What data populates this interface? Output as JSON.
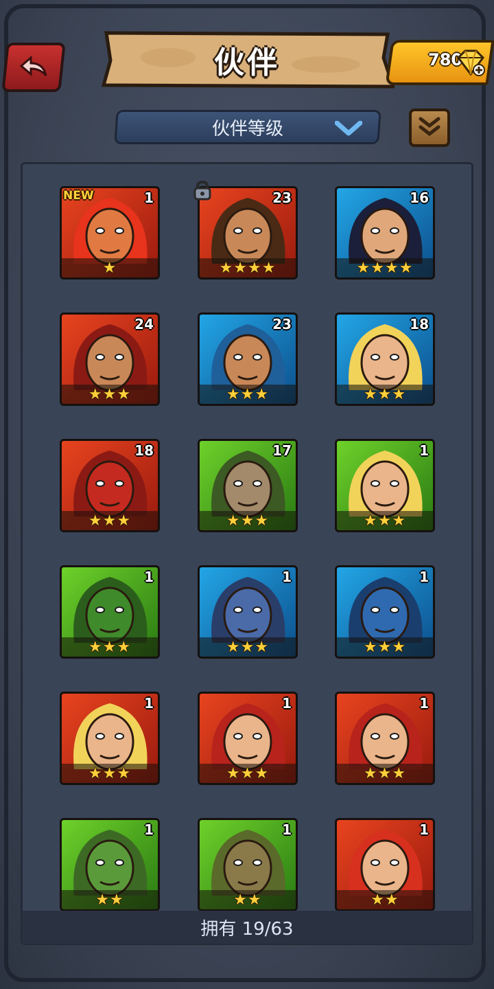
{
  "header": {
    "title": "伙伴",
    "currency_amount": "780"
  },
  "sort": {
    "label": "伙伴等级"
  },
  "companions": [
    {
      "level": "1",
      "stars": "★",
      "badge": "NEW",
      "color": "red",
      "locked": false,
      "face": "#e07a42",
      "hair": "#e8331d"
    },
    {
      "level": "23",
      "stars": "★★★★",
      "badge": "",
      "color": "red",
      "locked": true,
      "face": "#c98857",
      "hair": "#4a2a14"
    },
    {
      "level": "16",
      "stars": "★★★★",
      "badge": "",
      "color": "blue",
      "locked": false,
      "face": "#e0a87a",
      "hair": "#1b1f3a"
    },
    {
      "level": "24",
      "stars": "★★★",
      "badge": "",
      "color": "red",
      "locked": false,
      "face": "#c98857",
      "hair": "#8c1a14"
    },
    {
      "level": "23",
      "stars": "★★★",
      "badge": "",
      "color": "blue",
      "locked": false,
      "face": "#c98857",
      "hair": "#1f5f9a"
    },
    {
      "level": "18",
      "stars": "★★★",
      "badge": "",
      "color": "blue",
      "locked": false,
      "face": "#eab58a",
      "hair": "#f2d35a"
    },
    {
      "level": "18",
      "stars": "★★★",
      "badge": "",
      "color": "red",
      "locked": false,
      "face": "#c42a1f",
      "hair": "#8c1a14"
    },
    {
      "level": "17",
      "stars": "★★★",
      "badge": "",
      "color": "green",
      "locked": false,
      "face": "#a28a6a",
      "hair": "#3c5a24"
    },
    {
      "level": "1",
      "stars": "★★★",
      "badge": "",
      "color": "green",
      "locked": false,
      "face": "#eab58a",
      "hair": "#f2d35a"
    },
    {
      "level": "1",
      "stars": "★★★",
      "badge": "",
      "color": "green",
      "locked": false,
      "face": "#3f8a2a",
      "hair": "#2b5e1c"
    },
    {
      "level": "1",
      "stars": "★★★",
      "badge": "",
      "color": "blue",
      "locked": false,
      "face": "#4a6aa8",
      "hair": "#2a3e6a"
    },
    {
      "level": "1",
      "stars": "★★★",
      "badge": "",
      "color": "blue",
      "locked": false,
      "face": "#2f6ab0",
      "hair": "#1a3e6e"
    },
    {
      "level": "1",
      "stars": "★★★",
      "badge": "",
      "color": "red",
      "locked": false,
      "face": "#eab58a",
      "hair": "#f2d35a"
    },
    {
      "level": "1",
      "stars": "★★★",
      "badge": "",
      "color": "red",
      "locked": false,
      "face": "#eab58a",
      "hair": "#b8231c"
    },
    {
      "level": "1",
      "stars": "★★★",
      "badge": "",
      "color": "red",
      "locked": false,
      "face": "#eab58a",
      "hair": "#b8231c"
    },
    {
      "level": "1",
      "stars": "★★",
      "badge": "",
      "color": "green",
      "locked": false,
      "face": "#5a9a3a",
      "hair": "#3c6a24"
    },
    {
      "level": "1",
      "stars": "★★",
      "badge": "",
      "color": "green",
      "locked": false,
      "face": "#8a7a4a",
      "hair": "#5a6a2a"
    },
    {
      "level": "1",
      "stars": "★★",
      "badge": "",
      "color": "red",
      "locked": false,
      "face": "#eab58a",
      "hair": "#d8301f"
    }
  ],
  "footer": {
    "owned_text": "拥有 19/63"
  },
  "colors": {
    "red": "#d63a1c",
    "blue": "#1e88c8",
    "green": "#4cae24",
    "gold": "#ffcf3a"
  }
}
